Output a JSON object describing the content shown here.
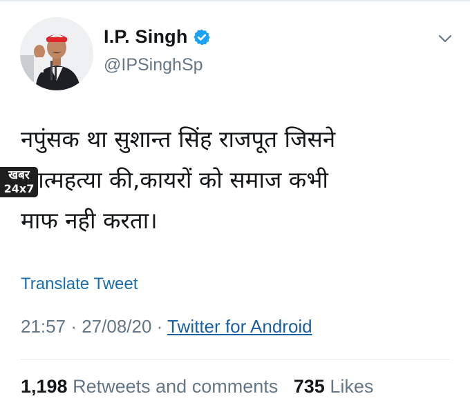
{
  "author": {
    "display_name": "I.P. Singh",
    "handle": "@IPSinghSp",
    "verified": true
  },
  "tweet": {
    "text": "नपुंसक था सुशान्त सिंह राजपूत जिसने\nआत्महत्या की,कायरों को समाज कभी\nमाफ नही करता।",
    "translate_label": "Translate Tweet",
    "time": "21:57",
    "separator": "·",
    "date": "27/08/20",
    "source": "Twitter for Android"
  },
  "stats": {
    "retweets_count": "1,198",
    "retweets_label": "Retweets and comments",
    "likes_count": "735",
    "likes_label": "Likes"
  },
  "watermark": {
    "top": "खबर",
    "bottom": "24x7"
  },
  "icons": {
    "verified": "verified-badge-icon",
    "menu": "chevron-down-icon"
  },
  "colors": {
    "verified": "#1da1f2",
    "link": "#1b6fb0",
    "secondary_text": "#657786",
    "avatar_cap": "#e0262b"
  }
}
